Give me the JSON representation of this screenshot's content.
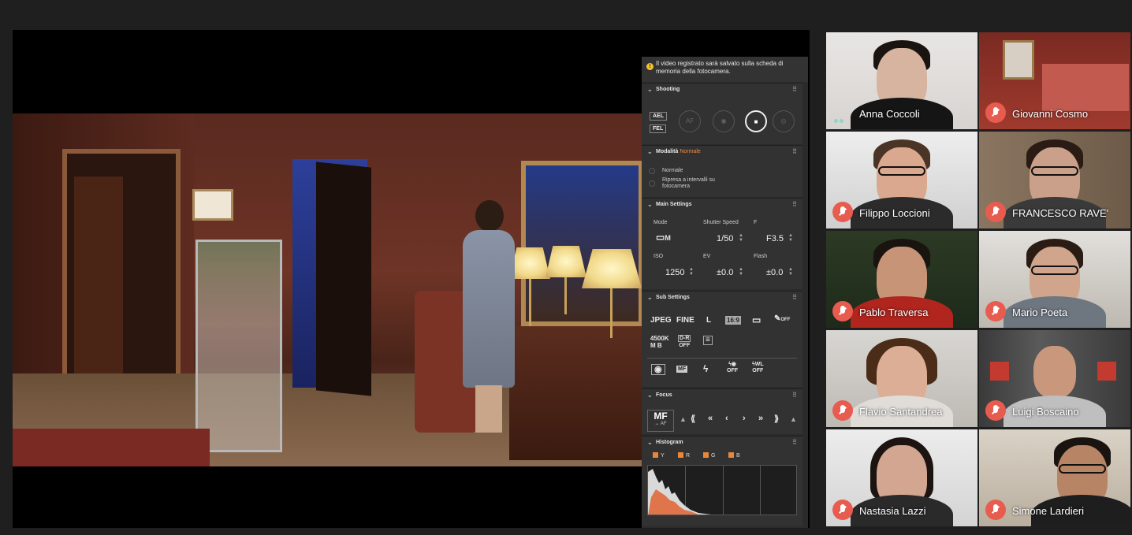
{
  "camera_panel": {
    "notice": "Il video registrato sarà salvato sulla scheda di memoria della fotocamera.",
    "shooting": {
      "title": "Shooting",
      "ael": "AEL",
      "fel": "FEL",
      "af_label": "AF"
    },
    "mode_section": {
      "title": "Modalità",
      "current": "Normale",
      "options": [
        "Normale",
        "Ripresa a intervalli su fotocamera"
      ]
    },
    "main_settings": {
      "title": "Main Settings",
      "mode_label": "Mode",
      "mode_value": "M",
      "shutter_label": "Shutter Speed",
      "shutter_value": "1/50",
      "f_label": "F",
      "f_value": "F3.5",
      "iso_label": "ISO",
      "iso_value": "1250",
      "ev_label": "EV",
      "ev_value": "±0.0",
      "flash_label": "Flash",
      "flash_value": "±0.0"
    },
    "sub_settings": {
      "title": "Sub Settings",
      "jpeg": "JPEG",
      "fine": "FINE",
      "size": "L",
      "aspect": "16:9",
      "off": "OFF",
      "wb": "4500K",
      "wb_sub": "M B",
      "dr_top": "D-R",
      "dr_bottom": "OFF",
      "mf": "MF",
      "off2": "OFF",
      "wl": "WL",
      "off3": "OFF"
    },
    "focus": {
      "title": "Focus",
      "mf": "MF",
      "af": "↔ AF"
    },
    "histogram": {
      "title": "Histogram",
      "channels": [
        "Y",
        "R",
        "G",
        "B"
      ]
    }
  },
  "participants": [
    {
      "name": "Anna Coccoli",
      "muted": false
    },
    {
      "name": "Giovanni Cosmo",
      "muted": true
    },
    {
      "name": "Filippo Loccioni",
      "muted": true
    },
    {
      "name": "FRANCESCO RAVE'",
      "muted": true
    },
    {
      "name": "Pablo Traversa",
      "muted": true
    },
    {
      "name": "Mario Poeta",
      "muted": true
    },
    {
      "name": "Flavio Santandrea",
      "muted": true
    },
    {
      "name": "Luigi Boscaino",
      "muted": true
    },
    {
      "name": "Nastasia Lazzi",
      "muted": true
    },
    {
      "name": "Simone Lardieri",
      "muted": true
    }
  ]
}
